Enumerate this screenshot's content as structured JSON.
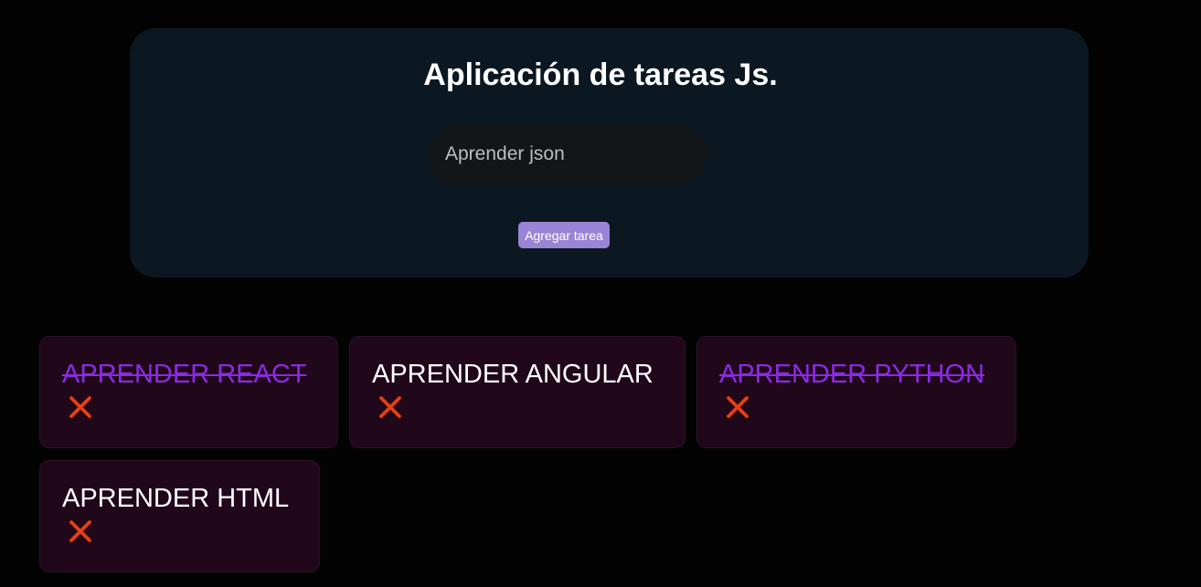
{
  "header": {
    "title": "Aplicación de tareas Js."
  },
  "form": {
    "input_value": "Aprender json",
    "add_button_label": "Agregar tarea"
  },
  "tasks": [
    {
      "text": "APRENDER REACT",
      "completed": true
    },
    {
      "text": "APRENDER ANGULAR",
      "completed": false
    },
    {
      "text": "APRENDER PYTHON",
      "completed": true
    },
    {
      "text": "APRENDER HTML",
      "completed": false
    }
  ],
  "icons": {
    "delete": "cross-mark-icon"
  },
  "colors": {
    "page_background": "#030304",
    "panel_background": "#0b1721",
    "button_accent": "#9a84d6",
    "card_background": "#20071a",
    "completed_text": "#8a2be2",
    "delete_icon": "#e8401c"
  }
}
